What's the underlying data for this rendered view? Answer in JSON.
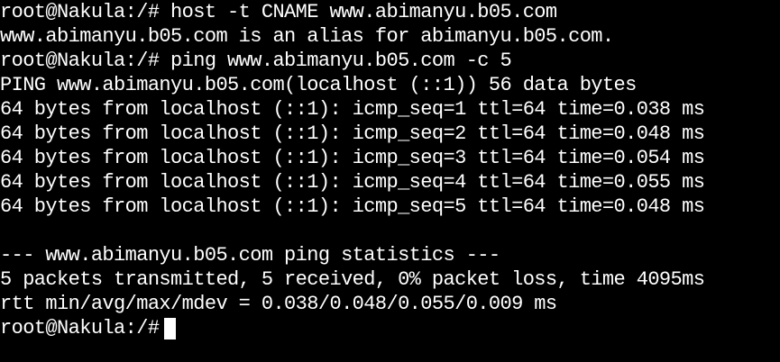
{
  "terminal": {
    "lines": [
      "root@Nakula:/# host -t CNAME www.abimanyu.b05.com",
      "www.abimanyu.b05.com is an alias for abimanyu.b05.com.",
      "root@Nakula:/# ping www.abimanyu.b05.com -c 5",
      "PING www.abimanyu.b05.com(localhost (::1)) 56 data bytes",
      "64 bytes from localhost (::1): icmp_seq=1 ttl=64 time=0.038 ms",
      "64 bytes from localhost (::1): icmp_seq=2 ttl=64 time=0.048 ms",
      "64 bytes from localhost (::1): icmp_seq=3 ttl=64 time=0.054 ms",
      "64 bytes from localhost (::1): icmp_seq=4 ttl=64 time=0.055 ms",
      "64 bytes from localhost (::1): icmp_seq=5 ttl=64 time=0.048 ms",
      "",
      "--- www.abimanyu.b05.com ping statistics ---",
      "5 packets transmitted, 5 received, 0% packet loss, time 4095ms",
      "rtt min/avg/max/mdev = 0.038/0.048/0.055/0.009 ms"
    ],
    "prompt": "root@Nakula:/#",
    "colors": {
      "background": "#000000",
      "foreground": "#ffffff"
    }
  }
}
